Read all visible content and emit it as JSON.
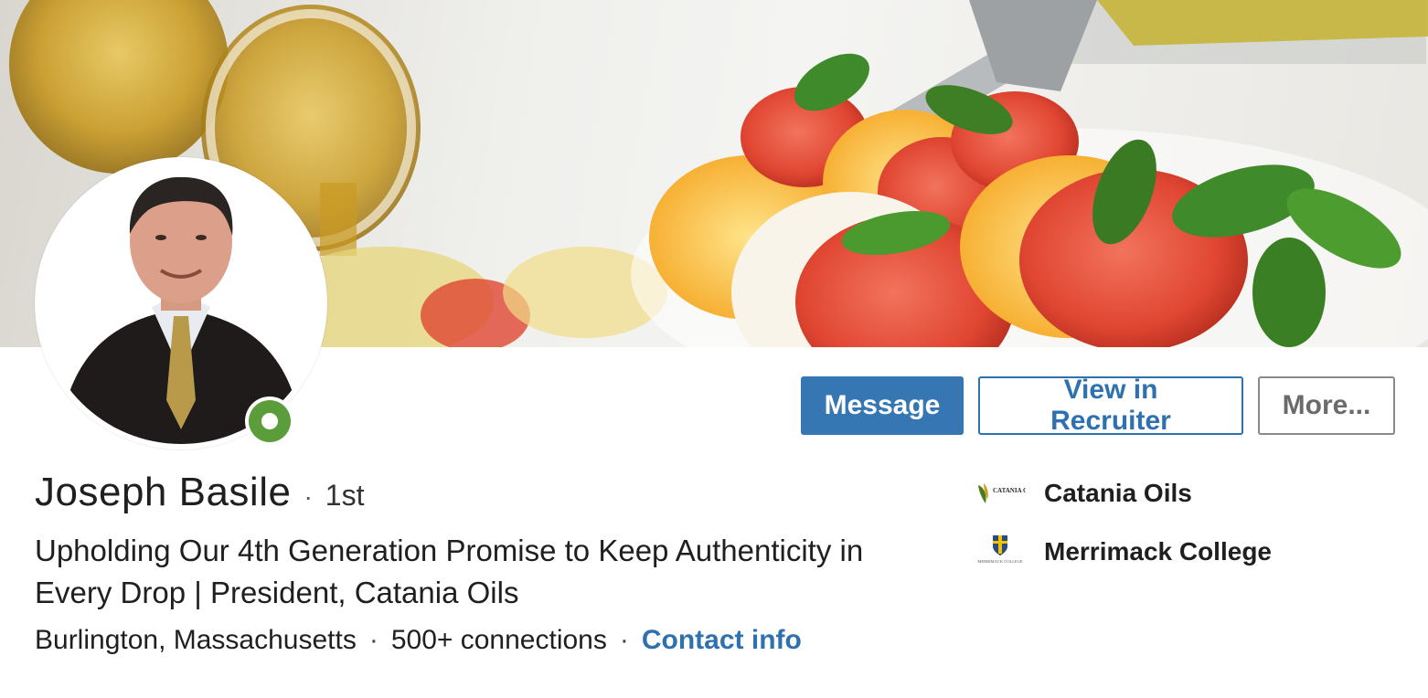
{
  "profile": {
    "name": "Joseph Basile",
    "degree": "1st",
    "headline": "Upholding Our 4th Generation Promise to Keep Authenticity in Every Drop | President, Catania Oils",
    "location": "Burlington, Massachusetts",
    "connections": "500+ connections",
    "contact_info": "Contact info",
    "separator": "·",
    "online": true
  },
  "actions": {
    "message": "Message",
    "view_in_recruiter": "View in Recruiter",
    "more": "More..."
  },
  "affiliations": [
    {
      "label": "Catania Oils",
      "logo_text": "CATANIA OILS",
      "icon": "catania-oils-logo"
    },
    {
      "label": "Merrimack College",
      "logo_text": "MERRIMACK COLLEGE",
      "icon": "merrimack-college-logo"
    }
  ],
  "colors": {
    "primary": "#3576b3",
    "link": "#2f71ae",
    "online": "#5b9d3a"
  }
}
